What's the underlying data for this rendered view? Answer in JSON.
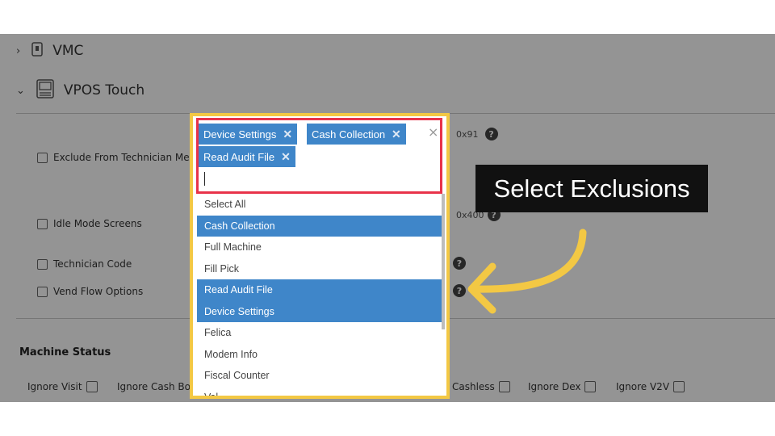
{
  "sections": {
    "vmc": {
      "label": "VMC",
      "icon": "vmc-device-icon"
    },
    "vpos": {
      "label": "VPOS Touch",
      "icon": "vpos-terminal-icon"
    }
  },
  "options": [
    {
      "label": "Exclude From Technician Menu",
      "hex": "0x91"
    },
    {
      "label": "Idle Mode Screens",
      "hex": "0x400"
    },
    {
      "label": "Technician Code",
      "hex": ""
    },
    {
      "label": "Vend Flow Options",
      "hex": ""
    }
  ],
  "machine_status": {
    "title": "Machine Status",
    "items": [
      "Ignore Visit",
      "Ignore Cash Box",
      "Cashless",
      "Ignore Dex",
      "Ignore V2V"
    ]
  },
  "dropdown": {
    "selected_tags": [
      "Device Settings",
      "Cash Collection",
      "Read Audit File"
    ],
    "clear_label": "×",
    "remove_label": "✕",
    "items": [
      {
        "label": "Select All",
        "selected": false
      },
      {
        "label": "Cash Collection",
        "selected": true
      },
      {
        "label": "Full Machine",
        "selected": false
      },
      {
        "label": "Fill Pick",
        "selected": false
      },
      {
        "label": "Read Audit File",
        "selected": true
      },
      {
        "label": "Device Settings",
        "selected": true
      },
      {
        "label": "Felica",
        "selected": false
      },
      {
        "label": "Modem Info",
        "selected": false
      },
      {
        "label": "Fiscal Counter",
        "selected": false
      },
      {
        "label": "Val...",
        "selected": false
      }
    ]
  },
  "callout": {
    "text": "Select Exclusions"
  },
  "colors": {
    "selection": "#3f86c9",
    "highlight_yellow": "#f3c844",
    "highlight_red": "#e8334a"
  }
}
